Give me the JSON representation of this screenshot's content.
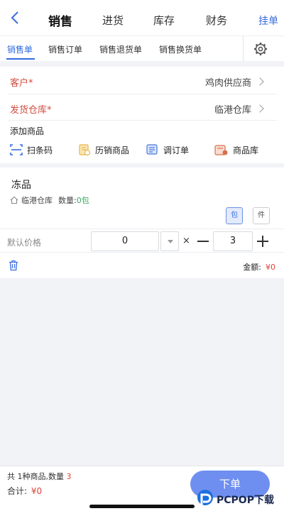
{
  "header": {
    "tabs": [
      "销售",
      "进货",
      "库存",
      "财务"
    ],
    "action_label": "挂单"
  },
  "subtabs": [
    "销售单",
    "销售订单",
    "销售退货单",
    "销售换货单"
  ],
  "form": {
    "customer_label": "客户*",
    "customer_value": "鸡肉供应商",
    "warehouse_label": "发货仓库*",
    "warehouse_value": "临港仓库",
    "add_title": "添加商品",
    "tools": [
      "扫条码",
      "历销商品",
      "调订单",
      "商品库"
    ]
  },
  "item": {
    "name": "冻品",
    "warehouse": "临港仓库",
    "qty_label": "数量:",
    "qty_value": "0包",
    "unit_primary": "包",
    "unit_secondary": "件",
    "price_label": "默认价格",
    "price_value": "0",
    "times": "×",
    "quantity": "3",
    "amount_label": "金额:",
    "amount_value": "¥0"
  },
  "footer": {
    "summary_prefix": "共",
    "kinds": "1",
    "summary_mid": "种商品,数量",
    "count": "3",
    "total_label": "合计:",
    "total_value": "¥0",
    "order_button": "下单"
  },
  "watermark": "PCPOP下载",
  "colors": {
    "accent_blue": "#2f6be0",
    "required_red": "#d24b40",
    "amount_red": "#e0423a",
    "qty_green": "#3aa85c",
    "order_button": "#6f8ff0"
  },
  "icons": [
    "back-icon",
    "gear-icon",
    "chevron-right-icon",
    "barcode-scan-icon",
    "history-goods-icon",
    "order-doc-icon",
    "goods-library-icon",
    "warehouse-house-icon",
    "trash-icon"
  ]
}
